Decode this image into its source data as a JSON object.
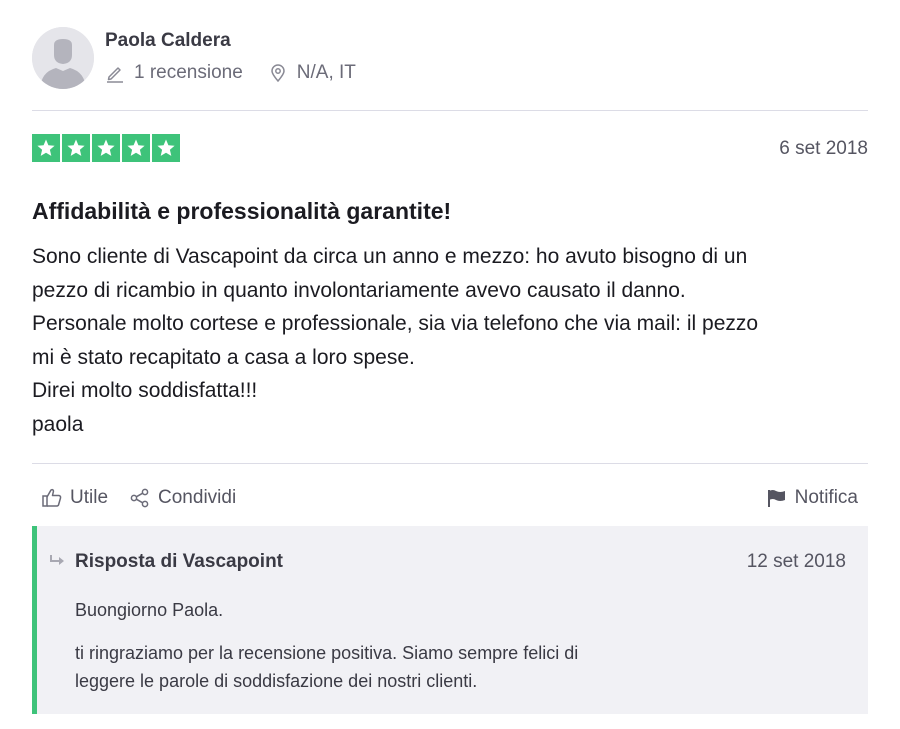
{
  "author": {
    "name": "Paola Caldera",
    "review_count": "1 recensione",
    "location": "N/A, IT"
  },
  "review": {
    "rating": 5,
    "rating_max": 5,
    "star_color": "#3ec37a",
    "date": "6 set 2018",
    "title": "Affidabilità e professionalità garantite!",
    "body_lines": [
      "Sono cliente di Vascapoint da circa un anno e mezzo: ho avuto bisogno di un",
      "pezzo di ricambio in quanto involontariamente avevo causato il danno.",
      "Personale molto cortese e professionale, sia via telefono che via mail: il pezzo",
      "mi è stato recapitato a casa a loro spese.",
      "Direi molto soddisfatta!!!",
      "paola"
    ]
  },
  "actions": {
    "useful_label": "Utile",
    "share_label": "Condividi",
    "report_label": "Notifica"
  },
  "reply": {
    "title": "Risposta di Vascapoint",
    "date": "12 set 2018",
    "greeting": "Buongiorno Paola.",
    "body_lines": [
      "ti ringraziamo per la recensione positiva. Siamo sempre felici di",
      "leggere le parole di soddisfazione dei nostri clienti."
    ],
    "accent_color": "#3ec37a"
  },
  "icons": [
    "user-avatar-icon",
    "pencil-icon",
    "location-pin-icon",
    "star-icon",
    "thumbs-up-icon",
    "share-icon",
    "flag-icon",
    "reply-arrow-icon"
  ]
}
